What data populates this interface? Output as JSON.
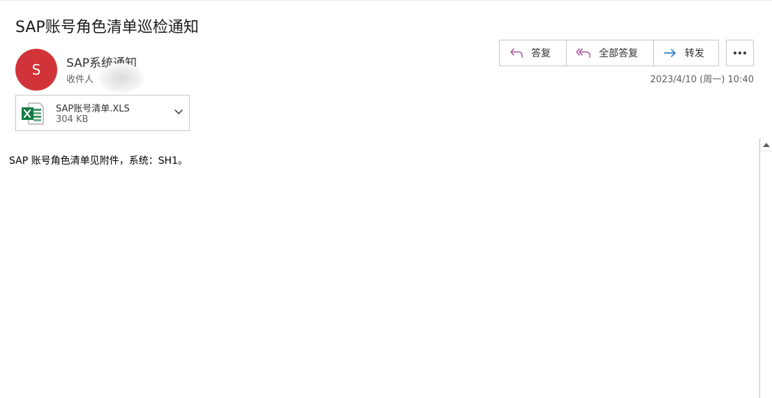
{
  "message": {
    "subject": "SAP账号角色清单巡检通知",
    "avatar_initial": "S",
    "avatar_color": "#d13438",
    "sender": "SAP系统通知",
    "recipient_label": "收件人",
    "timestamp": "2023/4/10 (周一) 10:40",
    "body": "SAP 账号角色清单见附件，系统：SH1。"
  },
  "actions": {
    "reply_label": "答复",
    "reply_all_label": "全部答复",
    "forward_label": "转发",
    "more_icon": "more-horizontal-icon",
    "accent_color": "#a4579f",
    "forward_color": "#0f6cbd"
  },
  "attachment": {
    "name": "SAP账号清单.XLS",
    "size": "304 KB",
    "icon": "excel-file-icon",
    "icon_color": "#107c41"
  }
}
